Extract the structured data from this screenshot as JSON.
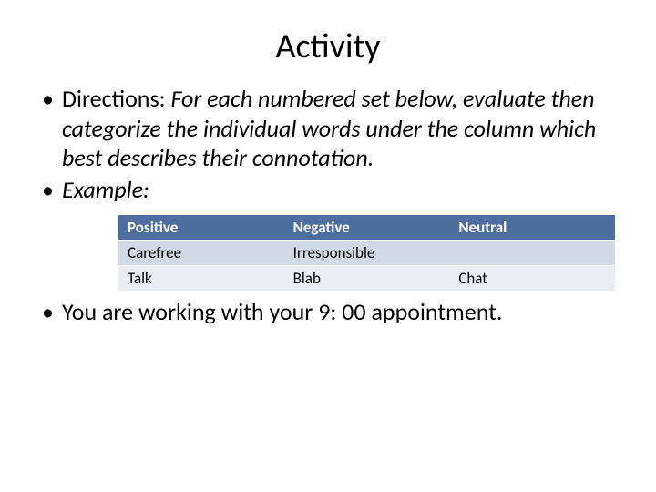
{
  "title": "Activity",
  "bullets": {
    "directions_label": "Directions: ",
    "directions_text": "For each numbered set below, evaluate then categorize the individual words under the column which best describes their connotation.",
    "example_label": "Example:",
    "closing": "You are working with your 9: 00 appointment."
  },
  "table": {
    "headers": [
      "Positive",
      "Negative",
      "Neutral"
    ],
    "rows": [
      [
        "Carefree",
        "Irresponsible",
        ""
      ],
      [
        "Talk",
        "Blab",
        "Chat"
      ]
    ]
  }
}
